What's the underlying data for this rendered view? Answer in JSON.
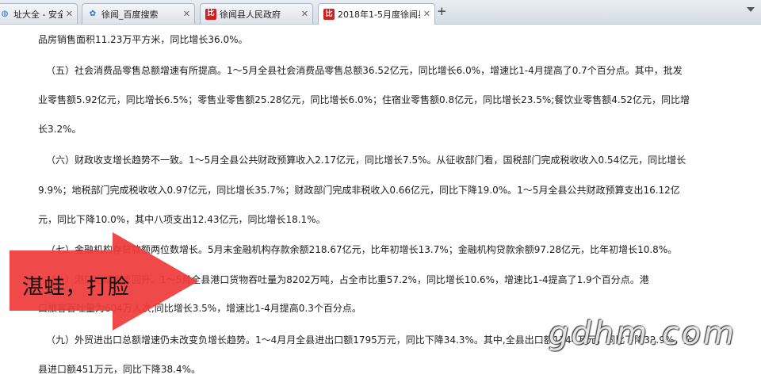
{
  "tabs": [
    {
      "title": "址大全 - 安全实…",
      "icon": "globe-icon",
      "active": false
    },
    {
      "title": "徐闻_百度搜索",
      "icon": "baidu-icon",
      "active": false
    },
    {
      "title": "徐闻县人民政府",
      "icon": "gov-emblem-icon",
      "active": false
    },
    {
      "title": "2018年1-5月度徐闻县…",
      "icon": "gov-emblem-icon",
      "active": true
    }
  ],
  "new_tab_label": "+",
  "article": {
    "lines": [
      "品房销售面积11.23万平方米，同比增长36.0%。",
      "（五）社会消费品零售总额增速有所提高。1～5月全县社会消费品零售总额36.52亿元，同比增长6.0%，增速比1-4月提高了0.7个百分点。其中，批发",
      "业零售额5.92亿元，同比增长6.5%；零售业零售额25.28亿元，同比增长6.0%；住宿业零售额0.8亿元，同比增长23.5%;餐饮业零售额4.52亿元，同比增",
      "长3.2%。",
      "（六）财政收支增长趋势不一致。1～5月全县公共财政预算收入2.17亿元，同比增长7.5%。从征收部门看，国税部门完成税收收入0.54亿元，同比增长",
      "9.9%；地税部门完成税收收入0.97亿元，同比增长35.7%；财政部门完成非税收入0.66亿元，同比下降19.0%。1～5月全县公共财政预算支出16.12亿",
      "元，同比下降10.0%，其中八项支出12.43亿元，同比增长18.1%。",
      "（七）金融机构存贷款额两位数增长。5月末金融机构存款余额218.67亿元，比年初增长13.7%；金融机构贷款余额97.28亿元，比年初增长10.8%。",
      "（八）港口运输逐步回升。1～5月全县港口货物吞吐量为8202万吨，占全市比重57.2%，同比增长10.6%，增速比1-4提高了1.9个百分点。港",
      "口旅客吞吐量为604万人次,同比增长3.5%，增速比1-4月提高0.3个百分点。",
      "（九）外贸进出口总额增速仍未改变负增长趋势。1～4月月全县进出口额1795万元，同比下降34.3%。其中,全县出口额1344万元，同比下降32.9%，全",
      "县进口额451万元，同比下降38.4%。"
    ]
  },
  "overlay": {
    "arrow_text": "湛蛙，打脸",
    "arrow_color": "#ef3b3b",
    "watermark": "gdhm.com"
  }
}
